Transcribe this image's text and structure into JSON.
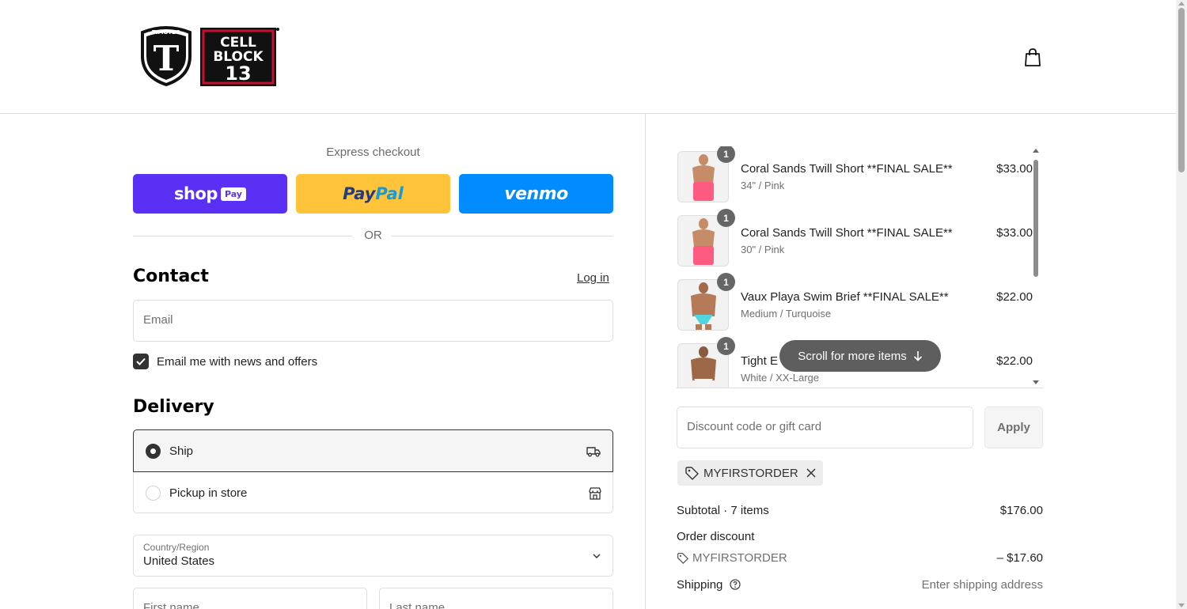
{
  "header": {
    "logo_left": "TIMOTEO",
    "logo_right": [
      "CELL",
      "BLOCK",
      "13"
    ],
    "cart_icon": "shopping-bag-icon"
  },
  "express": {
    "label": "Express checkout",
    "shoppay": {
      "word": "shop",
      "badge": "Pay",
      "color": "#5a31f4"
    },
    "paypal": {
      "part1": "Pay",
      "part2": "Pal",
      "color": "#ffc439"
    },
    "venmo": {
      "word": "venmo",
      "color": "#008cff"
    },
    "or": "OR"
  },
  "contact": {
    "title": "Contact",
    "login": "Log in",
    "email_placeholder": "Email",
    "newsletter_label": "Email me with news and offers",
    "newsletter_checked": true
  },
  "delivery": {
    "title": "Delivery",
    "options": [
      {
        "label": "Ship",
        "selected": true,
        "icon": "truck-icon"
      },
      {
        "label": "Pickup in store",
        "selected": false,
        "icon": "store-icon"
      }
    ],
    "country_label": "Country/Region",
    "country_value": "United States",
    "first_name_placeholder": "First name",
    "last_name_placeholder": "Last name"
  },
  "cart": {
    "items": [
      {
        "qty": "1",
        "name": "Coral Sands Twill Short **FINAL SALE**",
        "variant": "34\" / Pink",
        "price": "$33.00",
        "swatch": "#ff5b82"
      },
      {
        "qty": "1",
        "name": "Coral Sands Twill Short **FINAL SALE**",
        "variant": "30\" / Pink",
        "price": "$33.00",
        "swatch": "#ff5b82"
      },
      {
        "qty": "1",
        "name": "Vaux Playa Swim Brief **FINAL SALE**",
        "variant": "Medium / Turquoise",
        "price": "$22.00",
        "swatch": "#4fd6e0"
      },
      {
        "qty": "1",
        "name": "Tight E",
        "variant": "White / XX-Large",
        "price": "$22.00",
        "swatch": "#f4f4f4"
      }
    ],
    "scroll_hint": "Scroll for more items"
  },
  "discount": {
    "placeholder": "Discount code or gift card",
    "apply_label": "Apply",
    "applied_code": "MYFIRSTORDER"
  },
  "summary": {
    "subtotal_label": "Subtotal · 7 items",
    "subtotal_value": "$176.00",
    "order_discount_label": "Order discount",
    "discount_code": "MYFIRSTORDER",
    "discount_value": "– $17.60",
    "shipping_label": "Shipping",
    "shipping_value": "Enter shipping address"
  }
}
